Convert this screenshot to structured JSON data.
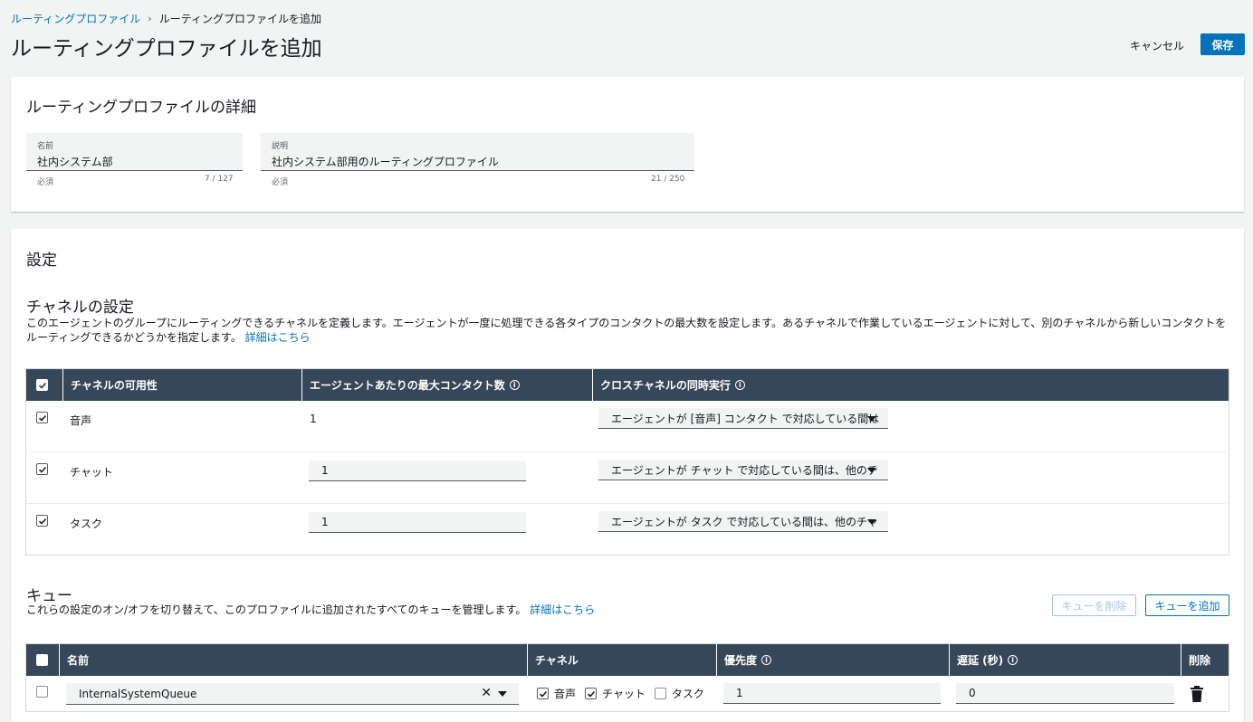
{
  "breadcrumb": {
    "parent": "ルーティングプロファイル",
    "separator": "›",
    "current": "ルーティングプロファイルを追加"
  },
  "header": {
    "title": "ルーティングプロファイルを追加",
    "cancel_label": "キャンセル",
    "save_label": "保存"
  },
  "details": {
    "title": "ルーティングプロファイルの詳細",
    "name": {
      "label": "名前",
      "value": "社内システム部",
      "hint": "必須",
      "count": "7 / 127"
    },
    "description": {
      "label": "説明",
      "value": "社内システム部用のルーティングプロファイル",
      "hint": "必須",
      "count": "21 / 250"
    }
  },
  "settings": {
    "title": "設定",
    "channels": {
      "title": "チャネルの設定",
      "description": "このエージェントのグループにルーティングできるチャネルを定義します。エージェントが一度に処理できる各タイプのコンタクトの最大数を設定します。あるチャネルで作業しているエージェントに対して、別のチャネルから新しいコンタクトをルーティングできるかどうかを指定します。",
      "link": "詳細はこちら",
      "columns": {
        "availability": "チャネルの可用性",
        "max_contacts": "エージェントあたりの最大コンタクト数",
        "cross_channel": "クロスチャネルの同時実行"
      },
      "rows": [
        {
          "name": "音声",
          "checked": true,
          "max": "1",
          "cross": "エージェントが [音声] コンタクト で対応している間は"
        },
        {
          "name": "チャット",
          "checked": true,
          "max": "1",
          "cross": "エージェントが チャット で対応している間は、他のチ"
        },
        {
          "name": "タスク",
          "checked": true,
          "max": "1",
          "cross": "エージェントが タスク で対応している間は、他のチャ"
        }
      ]
    },
    "queues": {
      "title": "キュー",
      "description": "これらの設定のオン/オフを切り替えて、このプロファイルに追加されたすべてのキューを管理します。",
      "link": "詳細はこちら",
      "delete_label": "キューを削除",
      "add_label": "キューを追加",
      "columns": {
        "name": "名前",
        "channel": "チャネル",
        "priority": "優先度",
        "delay": "遅延 (秒)",
        "delete": "削除"
      },
      "rows": [
        {
          "name": "InternalSystemQueue",
          "voice": "音声",
          "chat": "チャット",
          "task": "タスク",
          "priority": "1",
          "delay": "0"
        }
      ]
    }
  },
  "colors": {
    "accent": "#0073bb",
    "table_header": "#37475a"
  }
}
